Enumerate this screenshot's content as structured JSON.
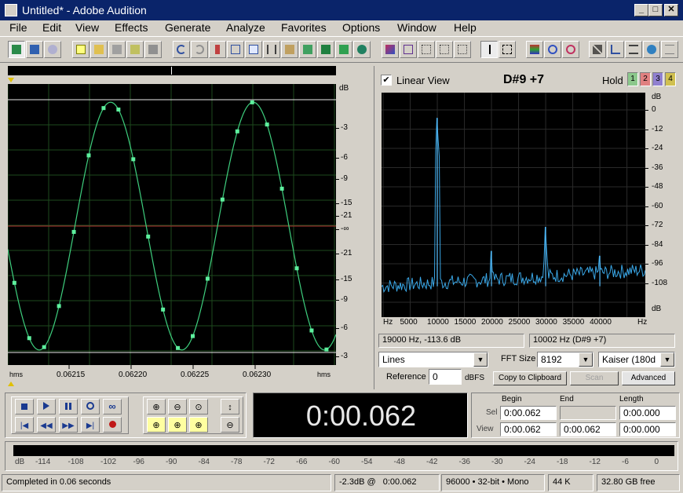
{
  "window": {
    "title": "Untitled* - Adobe Audition",
    "minimize": "_",
    "maximize": "□",
    "close": "✕"
  },
  "menu": [
    "File",
    "Edit",
    "View",
    "Effects",
    "Generate",
    "Analyze",
    "Favorites",
    "Options",
    "Window",
    "Help"
  ],
  "waveform": {
    "db_unit": "dB",
    "db_scale": [
      "-3",
      "-6",
      "-9",
      "-15",
      "-21",
      "-∞",
      "-21",
      "-15",
      "-9",
      "-6",
      "-3"
    ],
    "time_unit_left": "hms",
    "time_unit_right": "hms",
    "time_ticks": [
      "0.06215",
      "0.06220",
      "0.06225",
      "0.06230"
    ],
    "signal": {
      "frequency_hz": 10002,
      "sample_rate_hz": 96000,
      "view_start_s": 0.06211,
      "view_end_s": 0.06234,
      "peak_level": 0.98
    }
  },
  "analysis": {
    "linear_view_label": "Linear View",
    "note": "D#9 +7",
    "hold_label": "Hold",
    "hold_buttons": [
      "1",
      "2",
      "3",
      "4"
    ],
    "hold_colors": [
      "#8cc88c",
      "#e08080",
      "#9080d0",
      "#d0c050"
    ],
    "db_unit": "dB",
    "db_ticks": [
      "0",
      "-12",
      "-24",
      "-36",
      "-48",
      "-60",
      "-72",
      "-84",
      "-96",
      "-108"
    ],
    "hz_unit_left": "Hz",
    "hz_unit_right": "Hz",
    "hz_ticks": [
      "5000",
      "10000",
      "15000",
      "20000",
      "25000",
      "30000",
      "35000",
      "40000"
    ],
    "peaks": [
      {
        "hz": 10000,
        "db": -5
      },
      {
        "hz": 20000,
        "db": -88
      },
      {
        "hz": 30000,
        "db": -73
      },
      {
        "hz": 40000,
        "db": -91
      }
    ],
    "noise_floor_db": -110,
    "cursor_readout": "19000 Hz, -113.6 dB",
    "peak_readout": "10002 Hz (D#9 +7)",
    "mode_select": "Lines",
    "fft_label": "FFT Size",
    "fft_size": "8192",
    "window_select": "Kaiser (180d",
    "reference_label": "Reference",
    "reference_value": "0",
    "dbfs_label": "dBFS",
    "copy_button": "Copy to Clipboard",
    "scan_button": "Scan",
    "advanced_button": "Advanced"
  },
  "time_display": "0:00.062",
  "selection": {
    "begin_header": "Begin",
    "end_header": "End",
    "length_header": "Length",
    "sel_label": "Sel",
    "view_label": "View",
    "sel_begin": "0:00.062",
    "sel_end": "",
    "sel_length": "0:00.000",
    "view_begin": "0:00.062",
    "view_end": "0:00.062",
    "view_length": "0:00.000"
  },
  "level_meter": {
    "unit": "dB",
    "ticks": [
      "-114",
      "-108",
      "-102",
      "-96",
      "-90",
      "-84",
      "-78",
      "-72",
      "-66",
      "-60",
      "-54",
      "-48",
      "-42",
      "-36",
      "-30",
      "-24",
      "-18",
      "-12",
      "-6",
      "0"
    ]
  },
  "status": {
    "message": "Completed in 0.06 seconds",
    "level": "-2.3dB @",
    "time": "0:00.062",
    "format": "96000 • 32-bit • Mono",
    "size": "44 K",
    "free": "32.80 GB free"
  }
}
